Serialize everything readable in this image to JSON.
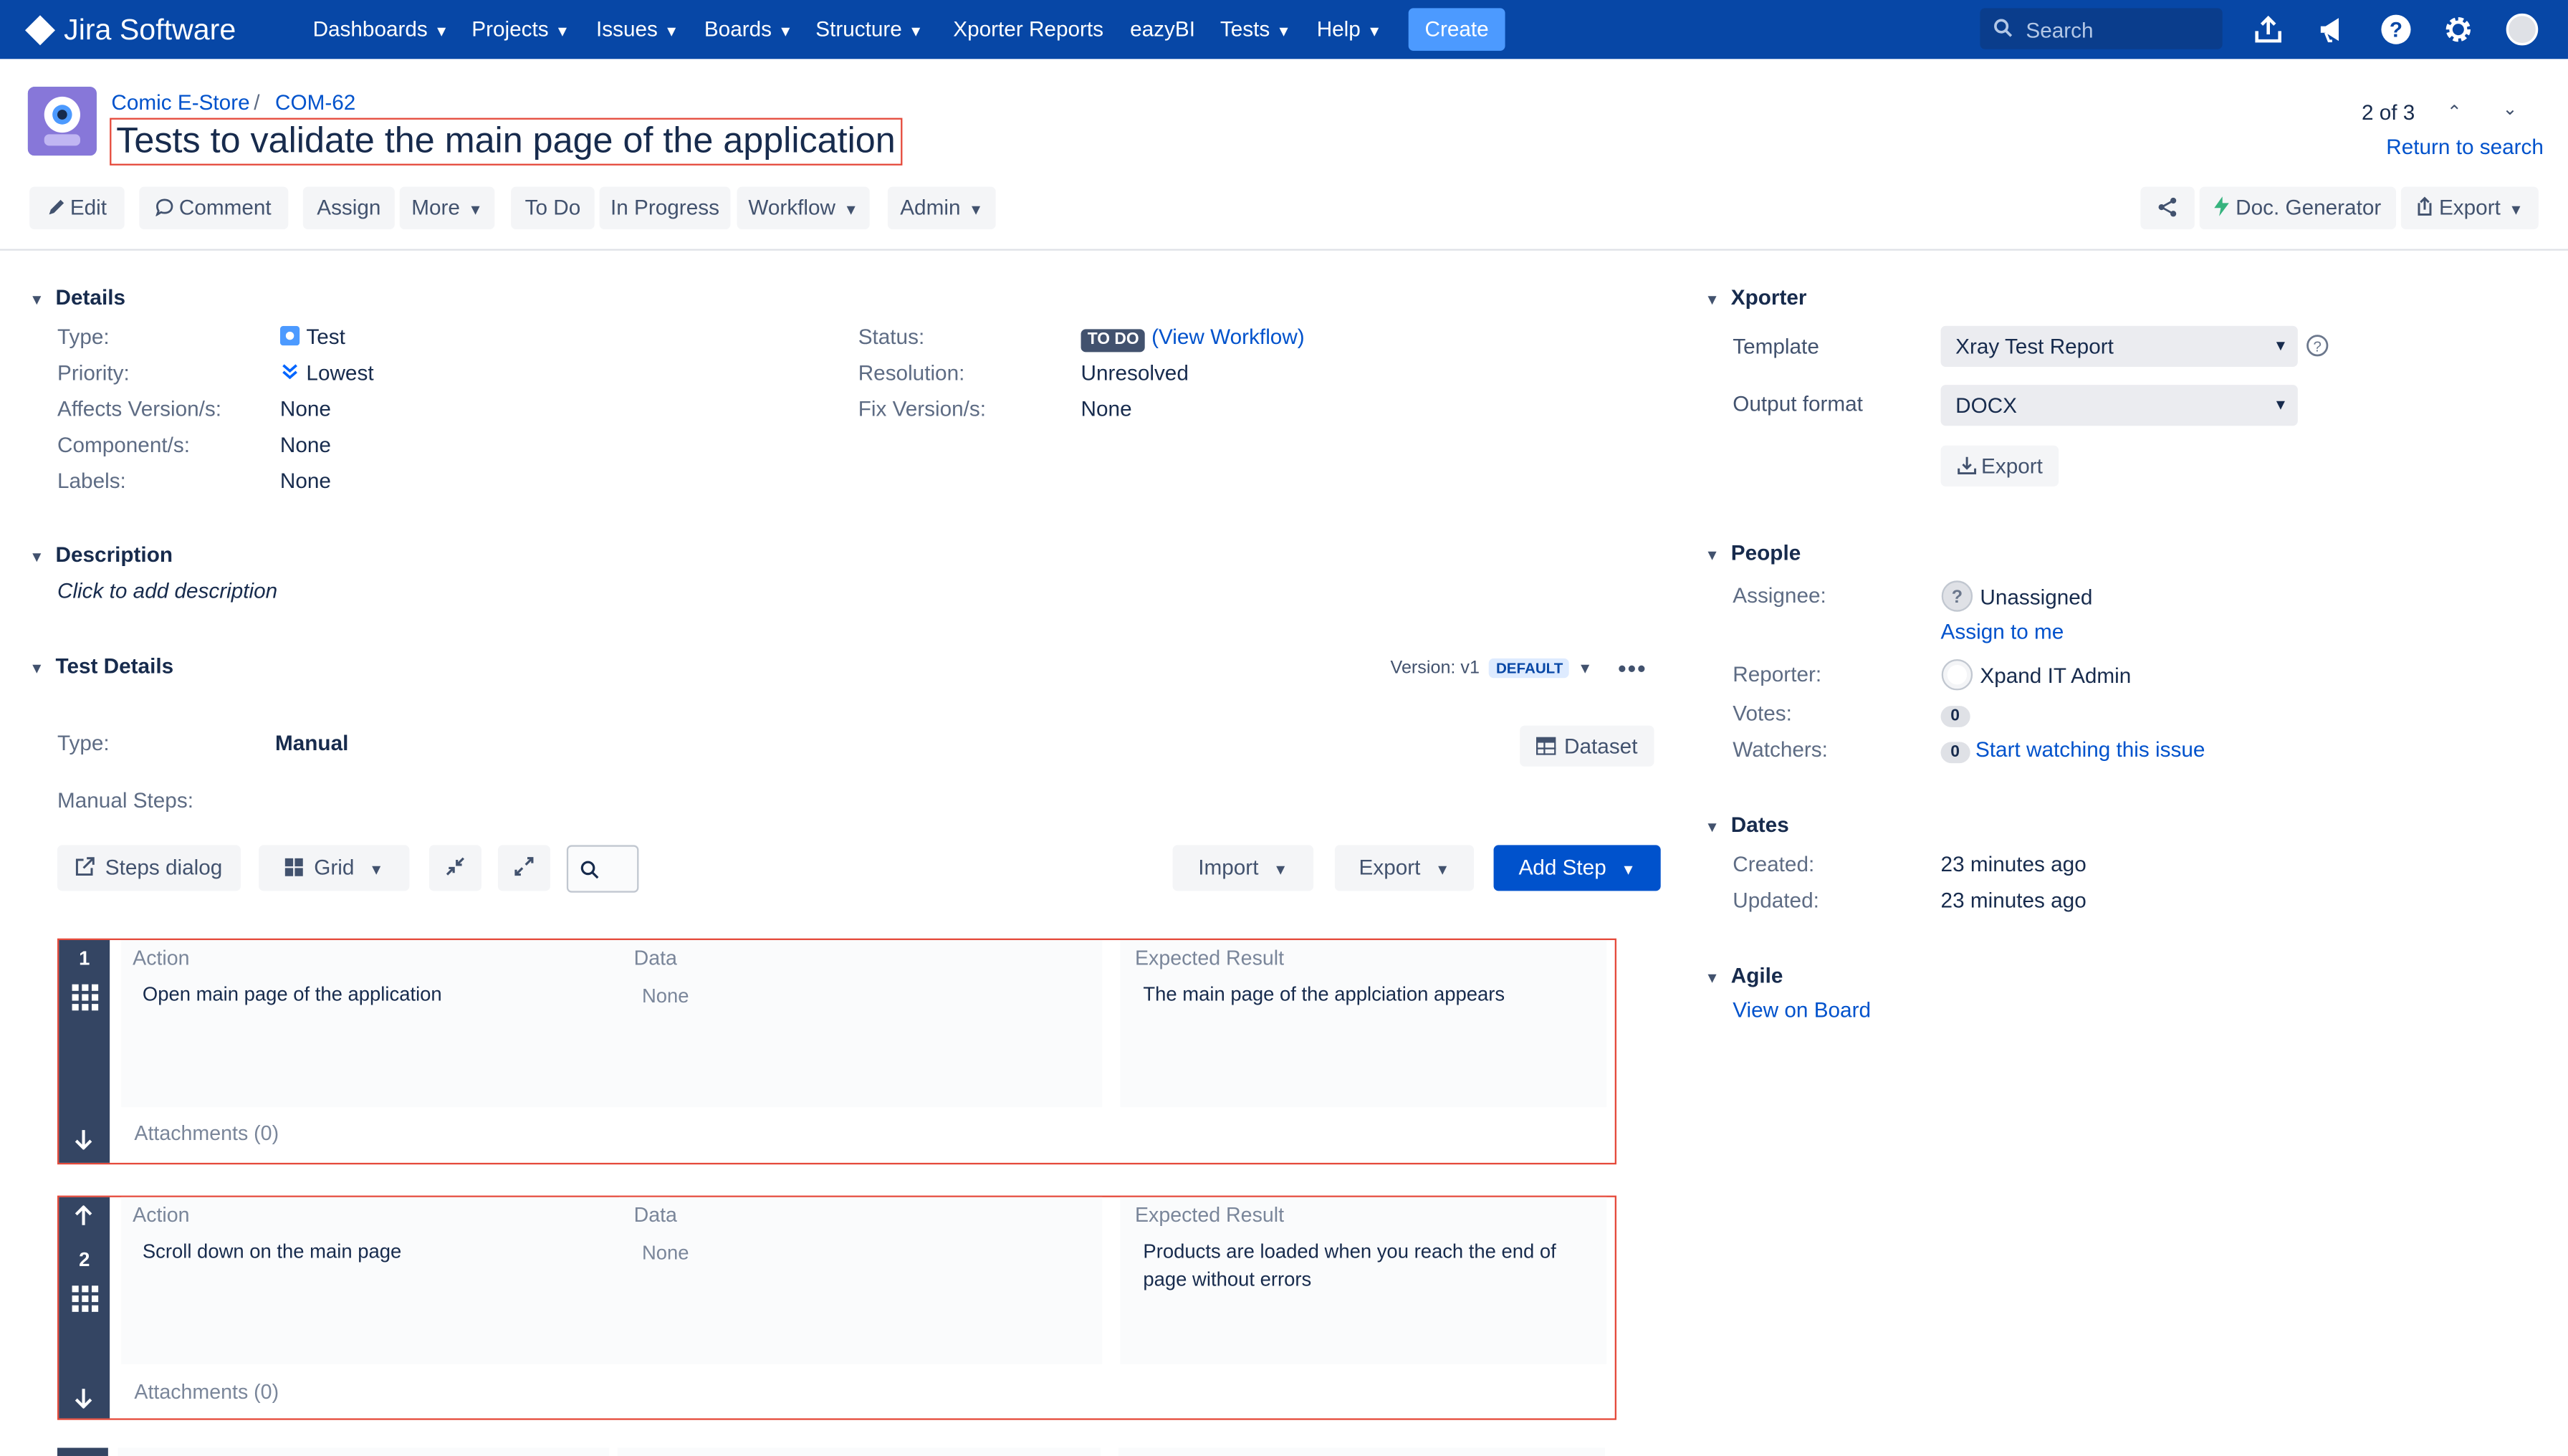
{
  "nav": {
    "app_name": "Jira Software",
    "menus": [
      "Dashboards",
      "Projects",
      "Issues",
      "Boards",
      "Structure"
    ],
    "plain_links": [
      "Xporter Reports",
      "eazyBI"
    ],
    "menus2": [
      "Tests",
      "Help"
    ],
    "create_label": "Create",
    "search_placeholder": "Search",
    "icons": [
      "upload-icon",
      "megaphone-icon",
      "help-icon",
      "gear-icon",
      "avatar"
    ]
  },
  "breadcrumb": {
    "project": "Comic E-Store",
    "sep": "/",
    "issue_key": "COM-62"
  },
  "issue": {
    "title": "Tests to validate the main page of the application"
  },
  "pager": {
    "position": "2 of 3",
    "return_label": "Return to search"
  },
  "toolbar": {
    "edit": "Edit",
    "comment": "Comment",
    "assign": "Assign",
    "more": "More",
    "todo": "To Do",
    "in_progress": "In Progress",
    "workflow": "Workflow",
    "admin": "Admin",
    "doc_generator": "Doc. Generator",
    "export": "Export"
  },
  "details": {
    "heading": "Details",
    "type_label": "Type:",
    "type_value": "Test",
    "priority_label": "Priority:",
    "priority_value": "Lowest",
    "affects_label": "Affects Version/s:",
    "affects_value": "None",
    "component_label": "Component/s:",
    "component_value": "None",
    "labels_label": "Labels:",
    "labels_value": "None",
    "status_label": "Status:",
    "status_value": "TO DO",
    "view_workflow": "View Workflow",
    "resolution_label": "Resolution:",
    "resolution_value": "Unresolved",
    "fix_label": "Fix Version/s:",
    "fix_value": "None"
  },
  "description": {
    "heading": "Description",
    "placeholder": "Click to add description"
  },
  "test_details": {
    "heading": "Test Details",
    "version_label": "Version: v1",
    "version_badge": "DEFAULT",
    "type_label": "Type:",
    "type_value": "Manual",
    "dataset_label": "Dataset",
    "manual_steps_label": "Manual Steps:",
    "steps_dialog": "Steps dialog",
    "grid": "Grid",
    "import": "Import",
    "export": "Export",
    "add_step": "Add Step"
  },
  "steps": [
    {
      "number": "1",
      "action_h": "Action",
      "data_h": "Data",
      "expected_h": "Expected Result",
      "action": "Open main page of the application",
      "data": "None",
      "expected": "The main page of the applciation appears",
      "attachments": "Attachments (0)"
    },
    {
      "number": "2",
      "action_h": "Action",
      "data_h": "Data",
      "expected_h": "Expected Result",
      "action": "Scroll down on the main page",
      "data": "None",
      "expected": "Products are loaded when you reach the end of page without errors",
      "attachments": "Attachments (0)"
    }
  ],
  "xporter": {
    "heading": "Xporter",
    "template_label": "Template",
    "template_value": "Xray Test Report",
    "output_label": "Output format",
    "output_value": "DOCX",
    "export_button": "Export"
  },
  "people": {
    "heading": "People",
    "assignee_label": "Assignee:",
    "assignee_value": "Unassigned",
    "assign_to_me": "Assign to me",
    "reporter_label": "Reporter:",
    "reporter_value": "Xpand IT Admin",
    "votes_label": "Votes:",
    "votes_value": "0",
    "watchers_label": "Watchers:",
    "watchers_value": "0",
    "start_watching": "Start watching this issue"
  },
  "dates": {
    "heading": "Dates",
    "created_label": "Created:",
    "created_value": "23 minutes ago",
    "updated_label": "Updated:",
    "updated_value": "23 minutes ago"
  },
  "agile": {
    "heading": "Agile",
    "view_on_board": "View on Board"
  }
}
